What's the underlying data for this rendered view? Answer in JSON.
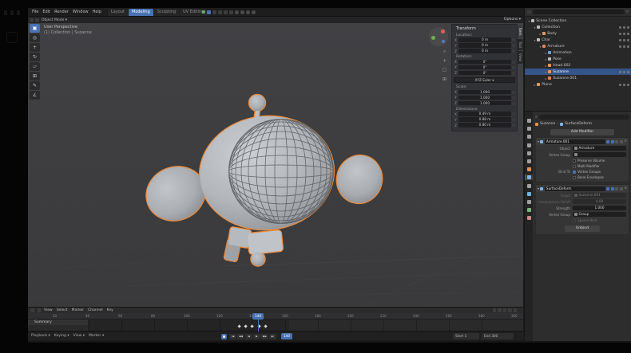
{
  "colors": {
    "accent": "#4772b3",
    "selection_outline": "#ea8b3c",
    "selected_row": "#35548a"
  },
  "topbar": {
    "menus": [
      "File",
      "Edit",
      "Render",
      "Window",
      "Help"
    ],
    "tabs": [
      {
        "label": "Layout",
        "active": false
      },
      {
        "label": "Modeling",
        "active": true
      },
      {
        "label": "Sculpting",
        "active": false
      },
      {
        "label": "UV Editing",
        "active": false
      }
    ],
    "right_icons": [
      "mode-indicator-icon",
      "snap-magnet-icon",
      "proportional-icon",
      "gizmo-toggle-icon",
      "overlay-toggle-icon",
      "xray-toggle-icon",
      "wireframe-shading-icon",
      "solid-shading-icon",
      "material-shading-icon",
      "rendered-shading-icon"
    ]
  },
  "viewport": {
    "mode": "Object Mode",
    "overlay_line1": "User Perspective",
    "overlay_line2": "(1) Collection | Suzanne",
    "options_label": "Options",
    "tools": [
      "box-select-tool",
      "cursor-tool",
      "move-tool",
      "rotate-tool",
      "scale-tool",
      "transform-tool",
      "annotate-tool",
      "measure-tool"
    ],
    "nav_icons": [
      "zoom-icon",
      "pan-icon",
      "camera-view-icon",
      "ortho-toggle-icon"
    ]
  },
  "sidebar": {
    "tabs": [
      {
        "label": "Item",
        "active": true
      },
      {
        "label": "Tool",
        "active": false
      },
      {
        "label": "View",
        "active": false
      }
    ],
    "title": "Transform",
    "sections": [
      {
        "label": "Location:",
        "rows": [
          [
            "X",
            "0 m"
          ],
          [
            "Y",
            "0 m"
          ],
          [
            "Z",
            "0 m"
          ]
        ]
      },
      {
        "label": "Rotation:",
        "rows": [
          [
            "X",
            "0°"
          ],
          [
            "Y",
            "0°"
          ],
          [
            "Z",
            "0°"
          ]
        ]
      },
      {
        "dropdown": "XYZ Euler"
      },
      {
        "label": "Scale:",
        "rows": [
          [
            "X",
            "1.000"
          ],
          [
            "Y",
            "1.000"
          ],
          [
            "Z",
            "1.000"
          ]
        ]
      },
      {
        "label": "Dimensions:",
        "rows": [
          [
            "X",
            "0.49 m"
          ],
          [
            "Y",
            "0.88 m"
          ],
          [
            "Z",
            "0.80 m"
          ]
        ]
      }
    ]
  },
  "outliner": {
    "rows": [
      {
        "label": "Scene Collection",
        "depth": 0,
        "icon": "collection",
        "expand": "▾",
        "rights": false,
        "selected": false
      },
      {
        "label": "Collection",
        "depth": 1,
        "icon": "collection",
        "expand": "▾",
        "rights": true,
        "selected": false
      },
      {
        "label": "Body",
        "depth": 2,
        "icon": "mesh",
        "expand": "▸",
        "rights": true,
        "selected": false
      },
      {
        "label": "Char",
        "depth": 1,
        "icon": "collection",
        "expand": "▾",
        "rights": true,
        "selected": false
      },
      {
        "label": "Armature",
        "depth": 2,
        "icon": "armature",
        "expand": "▾",
        "rights": true,
        "selected": false
      },
      {
        "label": "Animation",
        "depth": 3,
        "icon": "action",
        "expand": "▸",
        "rights": false,
        "selected": false
      },
      {
        "label": "Pose",
        "depth": 3,
        "icon": "pose",
        "expand": "▸",
        "rights": false,
        "selected": false
      },
      {
        "label": "Head.002",
        "depth": 3,
        "icon": "mesh",
        "expand": "▸",
        "rights": false,
        "selected": false
      },
      {
        "label": "Suzanne",
        "depth": 3,
        "icon": "mesh",
        "expand": "▸",
        "rights": true,
        "selected": true
      },
      {
        "label": "Suzanne.001",
        "depth": 3,
        "icon": "armature",
        "expand": "▸",
        "rights": false,
        "selected": false
      },
      {
        "label": "Plane",
        "depth": 1,
        "icon": "mesh",
        "expand": "▸",
        "rights": true,
        "selected": false
      }
    ]
  },
  "properties": {
    "tabs": [
      "tool-icon",
      "render-icon",
      "output-icon",
      "viewlayer-icon",
      "scene-icon",
      "world-icon",
      "object-icon",
      "modifiers-icon",
      "particles-icon",
      "physics-icon",
      "constraints-icon",
      "object-data-icon",
      "material-icon"
    ],
    "active_tab": "modifiers-icon",
    "breadcrumb_object": "Suzanne",
    "breadcrumb_modifier": "SurfaceDeform",
    "add_modifier": "Add Modifier",
    "modifiers": [
      {
        "name": "Armature.001",
        "rows": [
          {
            "label": "Object",
            "value": "Armature",
            "icon": true,
            "disabled": false,
            "num": false
          },
          {
            "label": "Vertex Group",
            "value": "",
            "icon": true,
            "disabled": false,
            "num": false
          }
        ],
        "checks": [
          {
            "label": "Preserve Volume",
            "checked": false,
            "disabled": false
          },
          {
            "label": "Multi Modifier",
            "checked": false,
            "disabled": false
          }
        ],
        "bind_label": "Bind To",
        "bind_options": [
          {
            "label": "Vertex Groups",
            "checked": true
          },
          {
            "label": "Bone Envelopes",
            "checked": false
          }
        ],
        "action_button": ""
      },
      {
        "name": "SurfaceDeform",
        "rows": [
          {
            "label": "Target",
            "value": "Suzanne.001",
            "icon": true,
            "disabled": true,
            "num": false
          },
          {
            "label": "Interpolation Falloff",
            "value": "4.00",
            "icon": false,
            "disabled": true,
            "num": true
          },
          {
            "label": "Strength",
            "value": "1.000",
            "icon": false,
            "disabled": false,
            "num": true
          },
          {
            "label": "Vertex Group",
            "value": "Group",
            "icon": true,
            "disabled": false,
            "num": false
          }
        ],
        "checks": [
          {
            "label": "Sparse Bind",
            "checked": false,
            "disabled": true
          }
        ],
        "bind_label": "",
        "bind_options": [],
        "action_button": "Unbind"
      }
    ]
  },
  "dopesheet": {
    "menus": [
      "View",
      "Select",
      "Marker",
      "Channel",
      "Key"
    ],
    "channel": "Summary",
    "ruler_labels": [
      20,
      40,
      60,
      80,
      100,
      120,
      140,
      160,
      180,
      200,
      220,
      240,
      260,
      280,
      300
    ],
    "current_frame": "140",
    "keyframes": [
      132,
      136,
      140,
      144,
      148
    ]
  },
  "timeline": {
    "menus": [
      "Playback",
      "Keying",
      "View",
      "Marker"
    ],
    "buttons": [
      "jump-start-button",
      "prev-keyframe-button",
      "play-reverse-button",
      "play-button",
      "next-keyframe-button",
      "jump-end-button"
    ],
    "current_frame": "140",
    "start_label": "Start",
    "start_value": "1",
    "end_label": "End",
    "end_value": "300"
  }
}
